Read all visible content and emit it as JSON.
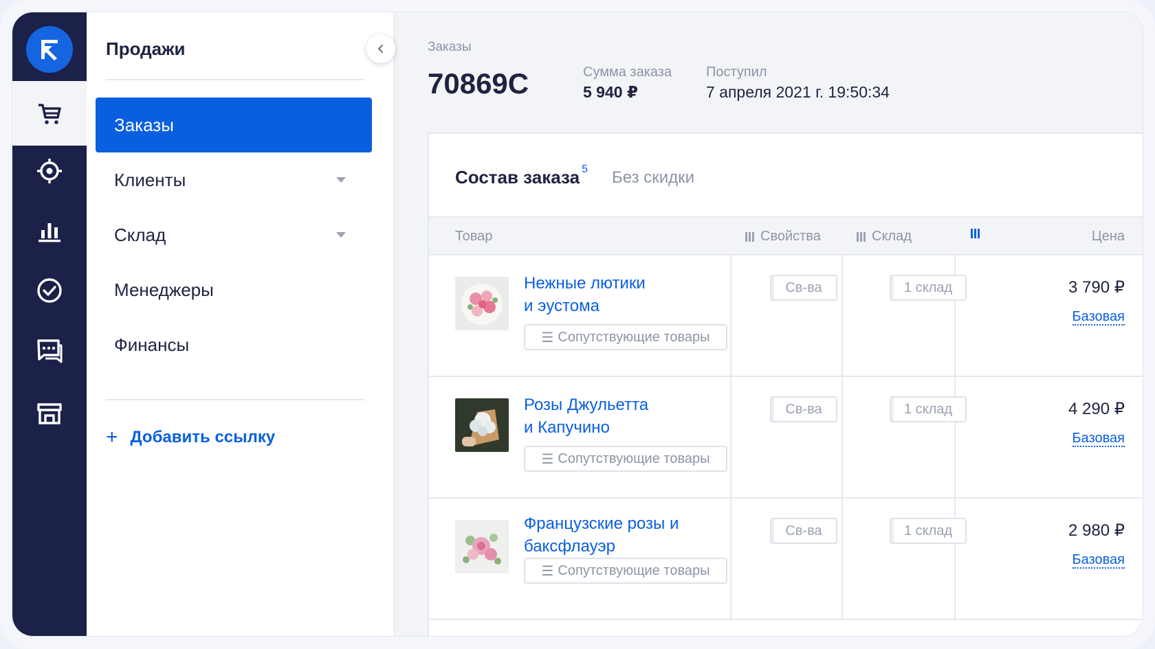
{
  "sidebar": {
    "title": "Продажи",
    "items": [
      {
        "label": "Заказы"
      },
      {
        "label": "Клиенты"
      },
      {
        "label": "Склад"
      },
      {
        "label": "Менеджеры"
      },
      {
        "label": "Финансы"
      }
    ],
    "add_link": "Добавить ссылку"
  },
  "rail": {
    "icons": [
      "logo-icon",
      "cart-icon",
      "target-icon",
      "chart-icon",
      "check-circle-icon",
      "chat-icon",
      "store-icon"
    ]
  },
  "header": {
    "breadcrumb": "Заказы",
    "order_id": "70869C",
    "sum_label": "Сумма заказа",
    "sum_value": "5 940 ₽",
    "received_label": "Поступил",
    "received_value": "7 апреля 2021 г. 19:50:34"
  },
  "card": {
    "title": "Состав заказа",
    "count": "5",
    "no_discount": "Без скидки",
    "columns": {
      "product": "Товар",
      "properties": "Свойства",
      "warehouse": "Склад",
      "price": "Цена"
    },
    "rows": [
      {
        "name_line1": "Нежные лютики",
        "name_line2": "и эустома",
        "related": "Сопутствующие товары",
        "props": "Св-ва",
        "stock": "1 склад",
        "price": "3 790 ₽",
        "price_type": "Базовая"
      },
      {
        "name_line1": "Розы Джульетта",
        "name_line2": "и Капучино",
        "related": "Сопутствующие товары",
        "props": "Св-ва",
        "stock": "1 склад",
        "price": "4 290 ₽",
        "price_type": "Базовая"
      },
      {
        "name_line1": "Французские розы и",
        "name_line2": "баксфлауэр",
        "related": "Сопутствующие товары",
        "props": "Св-ва",
        "stock": "1 склад",
        "price": "2 980 ₽",
        "price_type": "Базовая"
      }
    ]
  },
  "colors": {
    "accent": "#0a5fe0",
    "rail": "#1c2149",
    "text": "#1e2340",
    "muted": "#8d94a6"
  }
}
